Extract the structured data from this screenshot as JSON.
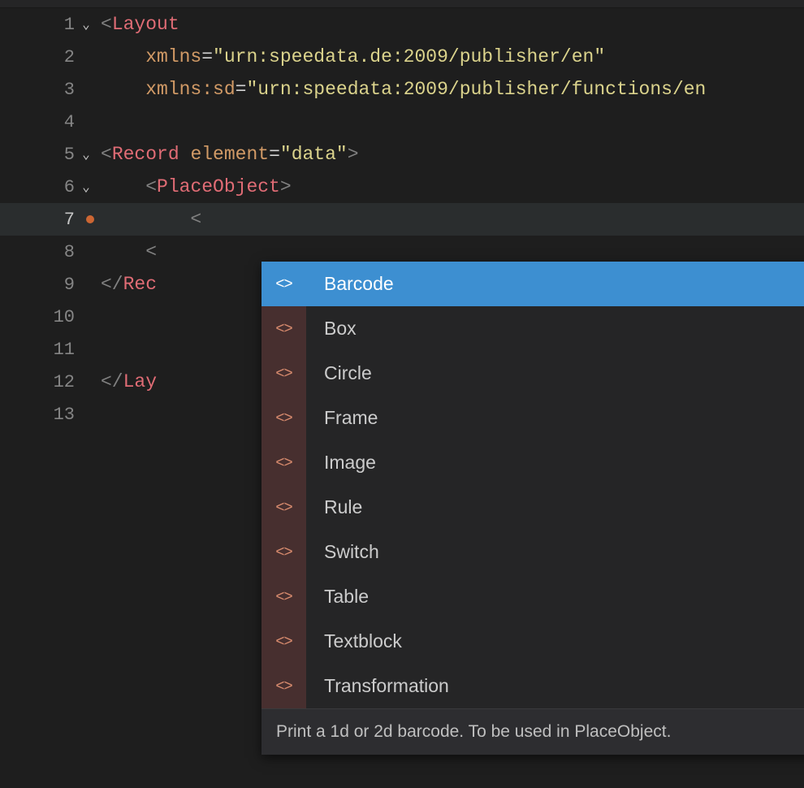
{
  "gutter": {
    "lines": [
      {
        "num": "1",
        "fold": "v"
      },
      {
        "num": "2"
      },
      {
        "num": "3"
      },
      {
        "num": "4"
      },
      {
        "num": "5",
        "fold": "v"
      },
      {
        "num": "6",
        "fold": "v"
      },
      {
        "num": "7",
        "active": true,
        "dot": true
      },
      {
        "num": "8"
      },
      {
        "num": "9"
      },
      {
        "num": "10"
      },
      {
        "num": "11"
      },
      {
        "num": "12"
      },
      {
        "num": "13"
      }
    ]
  },
  "code": {
    "l1": {
      "open": "<",
      "tag": "Layout"
    },
    "l2": {
      "attr": "xmlns",
      "eq": "=",
      "val": "\"urn:speedata.de:2009/publisher/en\""
    },
    "l3": {
      "ns": "xmlns:",
      "attr": "sd",
      "eq": "=",
      "val": "\"urn:speedata:2009/publisher/functions/en"
    },
    "l5": {
      "open": "<",
      "tag": "Record",
      "sp": " ",
      "attr": "element",
      "eq": "=",
      "val": "\"data\"",
      "close": ">"
    },
    "l6": {
      "open": "<",
      "tag": "PlaceObject",
      "close": ">"
    },
    "l7": {
      "open": "<"
    },
    "l8": {
      "partial": "<"
    },
    "l9": {
      "open": "</",
      "tag": "Rec"
    },
    "l12": {
      "open": "</",
      "tag": "Lay"
    }
  },
  "autocomplete": {
    "items": [
      {
        "label": "Barcode",
        "selected": true
      },
      {
        "label": "Box"
      },
      {
        "label": "Circle"
      },
      {
        "label": "Frame"
      },
      {
        "label": "Image"
      },
      {
        "label": "Rule"
      },
      {
        "label": "Switch"
      },
      {
        "label": "Table"
      },
      {
        "label": "Textblock"
      },
      {
        "label": "Transformation"
      }
    ],
    "icon_glyph": "<>",
    "description": "Print a 1d or 2d barcode. To be used in PlaceObject."
  }
}
